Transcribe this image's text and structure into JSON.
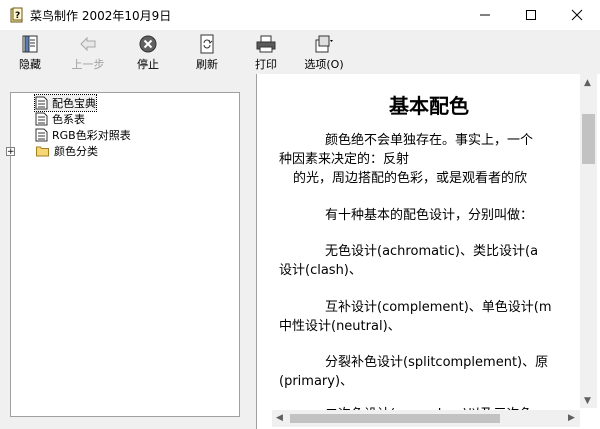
{
  "window": {
    "title": "菜鸟制作 2002年10月9日",
    "icon": "help-book-icon"
  },
  "toolbar": {
    "hide_label": "隐藏",
    "back_label": "上一步",
    "stop_label": "停止",
    "refresh_label": "刷新",
    "print_label": "打印",
    "options_label": "选项(O)"
  },
  "tree": {
    "items": [
      {
        "label": "配色宝典",
        "icon": "page-icon"
      },
      {
        "label": "色系表",
        "icon": "page-icon"
      },
      {
        "label": "RGB色彩对照表",
        "icon": "page-icon"
      },
      {
        "label": "颜色分类",
        "icon": "folder-icon"
      }
    ],
    "expand_symbol": "+"
  },
  "content": {
    "title": "基本配色",
    "lines": [
      "颜色绝不会单独存在。事实上，一个",
      "种因素来决定的：反射",
      "的光，周边搭配的色彩，或是观看者的欣",
      "有十种基本的配色设计，分别叫做：",
      "无色设计(achromatic)、类比设计(a",
      "设计(clash)、",
      "互补设计(complement)、单色设计(m",
      "中性设计(neutral)、",
      "分裂补色设计(splitcomplement)、原",
      "(primary)、",
      "二次色设计(secondary)以及三次色"
    ]
  }
}
